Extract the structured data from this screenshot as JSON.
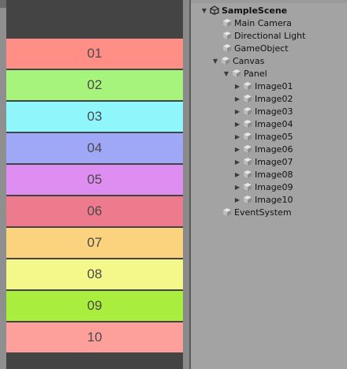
{
  "game_view": {
    "rows": [
      {
        "label": "01",
        "color": "#ff8f86"
      },
      {
        "label": "02",
        "color": "#a6f47c"
      },
      {
        "label": "03",
        "color": "#8ff6fb"
      },
      {
        "label": "04",
        "color": "#9fa7f7"
      },
      {
        "label": "05",
        "color": "#de8ef0"
      },
      {
        "label": "06",
        "color": "#ee7a8e"
      },
      {
        "label": "07",
        "color": "#fbd27e"
      },
      {
        "label": "08",
        "color": "#f4f78a"
      },
      {
        "label": "09",
        "color": "#a9ee3e"
      },
      {
        "label": "10",
        "color": "#fd9f9a"
      }
    ]
  },
  "hierarchy": {
    "scene": "SampleScene",
    "main_camera": "Main Camera",
    "directional_light": "Directional Light",
    "gameobject": "GameObject",
    "canvas": "Canvas",
    "panel": "Panel",
    "images": [
      "Image01",
      "Image02",
      "Image03",
      "Image04",
      "Image05",
      "Image06",
      "Image07",
      "Image08",
      "Image09",
      "Image10"
    ],
    "event_system": "EventSystem"
  }
}
